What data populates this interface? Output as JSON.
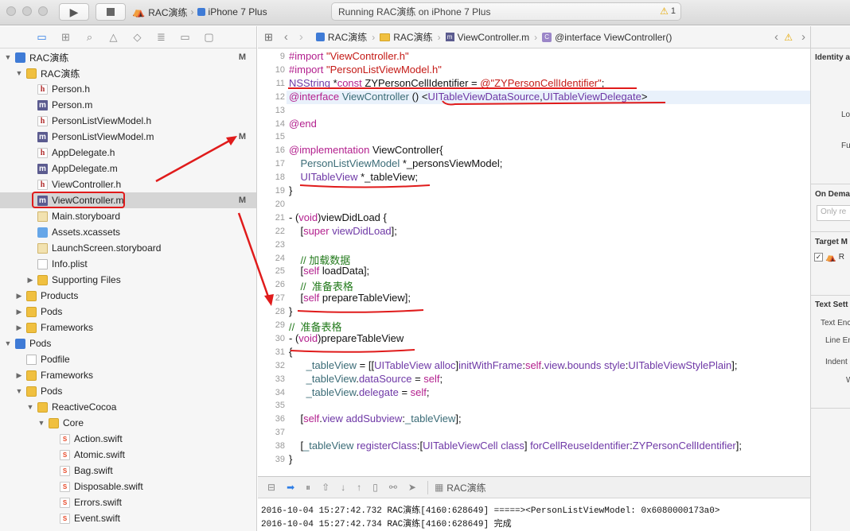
{
  "toolbar": {
    "scheme_project": "RAC演练",
    "scheme_device": "iPhone 7 Plus",
    "activity_text": "Running RAC演练 on iPhone 7 Plus",
    "warning_count": "1"
  },
  "navigator": {
    "items": [
      {
        "label": "RAC演练",
        "depth": 0,
        "icon": "project",
        "disclosure": "open",
        "badge": "M",
        "bold": true
      },
      {
        "label": "RAC演练",
        "depth": 1,
        "icon": "folder",
        "disclosure": "open",
        "badge": ""
      },
      {
        "label": "Person.h",
        "depth": 2,
        "icon": "h",
        "disclosure": "",
        "badge": ""
      },
      {
        "label": "Person.m",
        "depth": 2,
        "icon": "m",
        "disclosure": "",
        "badge": ""
      },
      {
        "label": "PersonListViewModel.h",
        "depth": 2,
        "icon": "h",
        "disclosure": "",
        "badge": ""
      },
      {
        "label": "PersonListViewModel.m",
        "depth": 2,
        "icon": "m",
        "disclosure": "",
        "badge": "M"
      },
      {
        "label": "AppDelegate.h",
        "depth": 2,
        "icon": "h",
        "disclosure": "",
        "badge": ""
      },
      {
        "label": "AppDelegate.m",
        "depth": 2,
        "icon": "m",
        "disclosure": "",
        "badge": ""
      },
      {
        "label": "ViewController.h",
        "depth": 2,
        "icon": "h",
        "disclosure": "",
        "badge": ""
      },
      {
        "label": "ViewController.m",
        "depth": 2,
        "icon": "m",
        "disclosure": "",
        "badge": "M",
        "selected": true
      },
      {
        "label": "Main.storyboard",
        "depth": 2,
        "icon": "storyboard",
        "disclosure": "",
        "badge": ""
      },
      {
        "label": "Assets.xcassets",
        "depth": 2,
        "icon": "xcassets",
        "disclosure": "",
        "badge": ""
      },
      {
        "label": "LaunchScreen.storyboard",
        "depth": 2,
        "icon": "storyboard",
        "disclosure": "",
        "badge": ""
      },
      {
        "label": "Info.plist",
        "depth": 2,
        "icon": "plist",
        "disclosure": "",
        "badge": ""
      },
      {
        "label": "Supporting Files",
        "depth": 2,
        "icon": "folder",
        "disclosure": "closed",
        "badge": ""
      },
      {
        "label": "Products",
        "depth": 1,
        "icon": "folder",
        "disclosure": "closed",
        "badge": ""
      },
      {
        "label": "Pods",
        "depth": 1,
        "icon": "folder",
        "disclosure": "closed",
        "badge": ""
      },
      {
        "label": "Frameworks",
        "depth": 1,
        "icon": "folder",
        "disclosure": "closed",
        "badge": ""
      },
      {
        "label": "Pods",
        "depth": 0,
        "icon": "project",
        "disclosure": "open",
        "badge": ""
      },
      {
        "label": "Podfile",
        "depth": 1,
        "icon": "file",
        "disclosure": "",
        "badge": ""
      },
      {
        "label": "Frameworks",
        "depth": 1,
        "icon": "folder",
        "disclosure": "closed",
        "badge": ""
      },
      {
        "label": "Pods",
        "depth": 1,
        "icon": "folder",
        "disclosure": "open",
        "badge": ""
      },
      {
        "label": "ReactiveCocoa",
        "depth": 2,
        "icon": "folder",
        "disclosure": "open",
        "badge": ""
      },
      {
        "label": "Core",
        "depth": 3,
        "icon": "folder",
        "disclosure": "open",
        "badge": ""
      },
      {
        "label": "Action.swift",
        "depth": 4,
        "icon": "swift",
        "disclosure": "",
        "badge": ""
      },
      {
        "label": "Atomic.swift",
        "depth": 4,
        "icon": "swift",
        "disclosure": "",
        "badge": ""
      },
      {
        "label": "Bag.swift",
        "depth": 4,
        "icon": "swift",
        "disclosure": "",
        "badge": ""
      },
      {
        "label": "Disposable.swift",
        "depth": 4,
        "icon": "swift",
        "disclosure": "",
        "badge": ""
      },
      {
        "label": "Errors.swift",
        "depth": 4,
        "icon": "swift",
        "disclosure": "",
        "badge": ""
      },
      {
        "label": "Event.swift",
        "depth": 4,
        "icon": "swift",
        "disclosure": "",
        "badge": ""
      }
    ]
  },
  "jumpbar": {
    "crumbs": [
      "RAC演练",
      "RAC演练",
      "ViewController.m",
      "@interface ViewController()"
    ]
  },
  "editor": {
    "lines": [
      {
        "n": "9",
        "segs": [
          {
            "t": "#import ",
            "c": "k"
          },
          {
            "t": "\"ViewController.h\"",
            "c": "s"
          }
        ]
      },
      {
        "n": "10",
        "segs": [
          {
            "t": "#import ",
            "c": "k"
          },
          {
            "t": "\"PersonListViewModel.h\"",
            "c": "s"
          }
        ]
      },
      {
        "n": "11",
        "segs": [
          {
            "t": "NSString",
            "c": "t"
          },
          {
            "t": " *",
            "c": ""
          },
          {
            "t": "const",
            "c": "k"
          },
          {
            "t": " ZYPersonCellIdentifier = ",
            "c": ""
          },
          {
            "t": "@\"ZYPersonCellIdentifier\"",
            "c": "s"
          },
          {
            "t": ";",
            "c": ""
          }
        ]
      },
      {
        "n": "12",
        "hl": true,
        "segs": [
          {
            "t": "@interface",
            "c": "k"
          },
          {
            "t": " ",
            "c": ""
          },
          {
            "t": "ViewController",
            "c": "f"
          },
          {
            "t": " () <",
            "c": ""
          },
          {
            "t": "UITableViewDataSource",
            "c": "t"
          },
          {
            "t": ",",
            "c": ""
          },
          {
            "t": "UITableViewDelegate",
            "c": "t"
          },
          {
            "t": ">",
            "c": ""
          }
        ]
      },
      {
        "n": "13",
        "segs": []
      },
      {
        "n": "14",
        "segs": [
          {
            "t": "@end",
            "c": "k"
          }
        ]
      },
      {
        "n": "15",
        "segs": []
      },
      {
        "n": "16",
        "segs": [
          {
            "t": "@implementation",
            "c": "k"
          },
          {
            "t": " ViewController{",
            "c": ""
          }
        ]
      },
      {
        "n": "17",
        "segs": [
          {
            "t": "    ",
            "c": ""
          },
          {
            "t": "PersonListViewModel",
            "c": "f"
          },
          {
            "t": " *_personsViewModel;",
            "c": ""
          }
        ]
      },
      {
        "n": "18",
        "segs": [
          {
            "t": "    ",
            "c": ""
          },
          {
            "t": "UITableView",
            "c": "t"
          },
          {
            "t": " *_tableView;",
            "c": ""
          }
        ]
      },
      {
        "n": "19",
        "segs": [
          {
            "t": "}",
            "c": ""
          }
        ]
      },
      {
        "n": "20",
        "segs": []
      },
      {
        "n": "21",
        "segs": [
          {
            "t": "- (",
            "c": ""
          },
          {
            "t": "void",
            "c": "k"
          },
          {
            "t": ")viewDidLoad {",
            "c": ""
          }
        ]
      },
      {
        "n": "22",
        "segs": [
          {
            "t": "    [",
            "c": ""
          },
          {
            "t": "super",
            "c": "k"
          },
          {
            "t": " ",
            "c": ""
          },
          {
            "t": "viewDidLoad",
            "c": "t"
          },
          {
            "t": "];",
            "c": ""
          }
        ]
      },
      {
        "n": "23",
        "segs": []
      },
      {
        "n": "24",
        "segs": [
          {
            "t": "    // 加载数据",
            "c": "c"
          }
        ]
      },
      {
        "n": "25",
        "segs": [
          {
            "t": "    [",
            "c": ""
          },
          {
            "t": "self",
            "c": "k"
          },
          {
            "t": " loadData];",
            "c": ""
          }
        ]
      },
      {
        "n": "26",
        "segs": [
          {
            "t": "    //  准备表格",
            "c": "c"
          }
        ]
      },
      {
        "n": "27",
        "segs": [
          {
            "t": "    [",
            "c": ""
          },
          {
            "t": "self",
            "c": "k"
          },
          {
            "t": " prepareTableView];",
            "c": ""
          }
        ]
      },
      {
        "n": "28",
        "segs": [
          {
            "t": "}",
            "c": ""
          }
        ]
      },
      {
        "n": "29",
        "segs": [
          {
            "t": "//  准备表格",
            "c": "c"
          }
        ]
      },
      {
        "n": "30",
        "segs": [
          {
            "t": "- (",
            "c": ""
          },
          {
            "t": "void",
            "c": "k"
          },
          {
            "t": ")prepareTableView",
            "c": ""
          }
        ]
      },
      {
        "n": "31",
        "segs": [
          {
            "t": "{",
            "c": ""
          }
        ]
      },
      {
        "n": "32",
        "segs": [
          {
            "t": "      ",
            "c": ""
          },
          {
            "t": "_tableView",
            "c": "f"
          },
          {
            "t": " = [[",
            "c": ""
          },
          {
            "t": "UITableView",
            "c": "t"
          },
          {
            "t": " ",
            "c": ""
          },
          {
            "t": "alloc",
            "c": "t"
          },
          {
            "t": "]",
            "c": ""
          },
          {
            "t": "initWithFrame",
            "c": "t"
          },
          {
            "t": ":",
            "c": ""
          },
          {
            "t": "self",
            "c": "k"
          },
          {
            "t": ".",
            "c": ""
          },
          {
            "t": "view",
            "c": "t"
          },
          {
            "t": ".",
            "c": ""
          },
          {
            "t": "bounds",
            "c": "t"
          },
          {
            "t": " ",
            "c": ""
          },
          {
            "t": "style",
            "c": "t"
          },
          {
            "t": ":",
            "c": ""
          },
          {
            "t": "UITableViewStylePlain",
            "c": "t"
          },
          {
            "t": "];",
            "c": ""
          }
        ]
      },
      {
        "n": "33",
        "segs": [
          {
            "t": "      ",
            "c": ""
          },
          {
            "t": "_tableView",
            "c": "f"
          },
          {
            "t": ".",
            "c": ""
          },
          {
            "t": "dataSource",
            "c": "t"
          },
          {
            "t": " = ",
            "c": ""
          },
          {
            "t": "self",
            "c": "k"
          },
          {
            "t": ";",
            "c": ""
          }
        ]
      },
      {
        "n": "34",
        "segs": [
          {
            "t": "      ",
            "c": ""
          },
          {
            "t": "_tableView",
            "c": "f"
          },
          {
            "t": ".",
            "c": ""
          },
          {
            "t": "delegate",
            "c": "t"
          },
          {
            "t": " = ",
            "c": ""
          },
          {
            "t": "self",
            "c": "k"
          },
          {
            "t": ";",
            "c": ""
          }
        ]
      },
      {
        "n": "35",
        "segs": []
      },
      {
        "n": "36",
        "segs": [
          {
            "t": "    [",
            "c": ""
          },
          {
            "t": "self",
            "c": "k"
          },
          {
            "t": ".",
            "c": ""
          },
          {
            "t": "view",
            "c": "t"
          },
          {
            "t": " ",
            "c": ""
          },
          {
            "t": "addSubview",
            "c": "t"
          },
          {
            "t": ":",
            "c": ""
          },
          {
            "t": "_tableView",
            "c": "f"
          },
          {
            "t": "];",
            "c": ""
          }
        ]
      },
      {
        "n": "37",
        "segs": []
      },
      {
        "n": "38",
        "segs": [
          {
            "t": "    [",
            "c": ""
          },
          {
            "t": "_tableView",
            "c": "f"
          },
          {
            "t": " ",
            "c": ""
          },
          {
            "t": "registerClass",
            "c": "t"
          },
          {
            "t": ":[",
            "c": ""
          },
          {
            "t": "UITableViewCell",
            "c": "t"
          },
          {
            "t": " ",
            "c": ""
          },
          {
            "t": "class",
            "c": "t"
          },
          {
            "t": "] ",
            "c": ""
          },
          {
            "t": "forCellReuseIdentifier",
            "c": "t"
          },
          {
            "t": ":",
            "c": ""
          },
          {
            "t": "ZYPersonCellIdentifier",
            "c": "t"
          },
          {
            "t": "];",
            "c": ""
          }
        ]
      },
      {
        "n": "39",
        "segs": [
          {
            "t": "}",
            "c": ""
          }
        ]
      }
    ]
  },
  "debug": {
    "target_label": "RAC演练"
  },
  "console": {
    "lines": [
      "2016-10-04 15:27:42.732 RAC演练[4160:628649] =====><PersonListViewModel: 0x6080000173a0>",
      "2016-10-04 15:27:42.734 RAC演练[4160:628649] 完成"
    ]
  },
  "inspector": {
    "identity_title": "Identity a",
    "location_label": "Lo",
    "full_path_label": "Fu",
    "on_demand_title": "On Dema",
    "on_demand_placeholder": "Only re",
    "target_title": "Target M",
    "target_item": "R",
    "text_settings_title": "Text Sett",
    "text_encoding_label": "Text Enc",
    "line_endings_label": "Line En",
    "indent_label": "Indent",
    "width_label": "W"
  },
  "colors": {
    "keyword": "#b3208e",
    "string": "#c41a16",
    "type": "#6e38a6",
    "project_symbol": "#3a6b76",
    "comment": "#237a1c",
    "annotation": "#e01b1b",
    "selection_bg": "#d5d5d5"
  }
}
